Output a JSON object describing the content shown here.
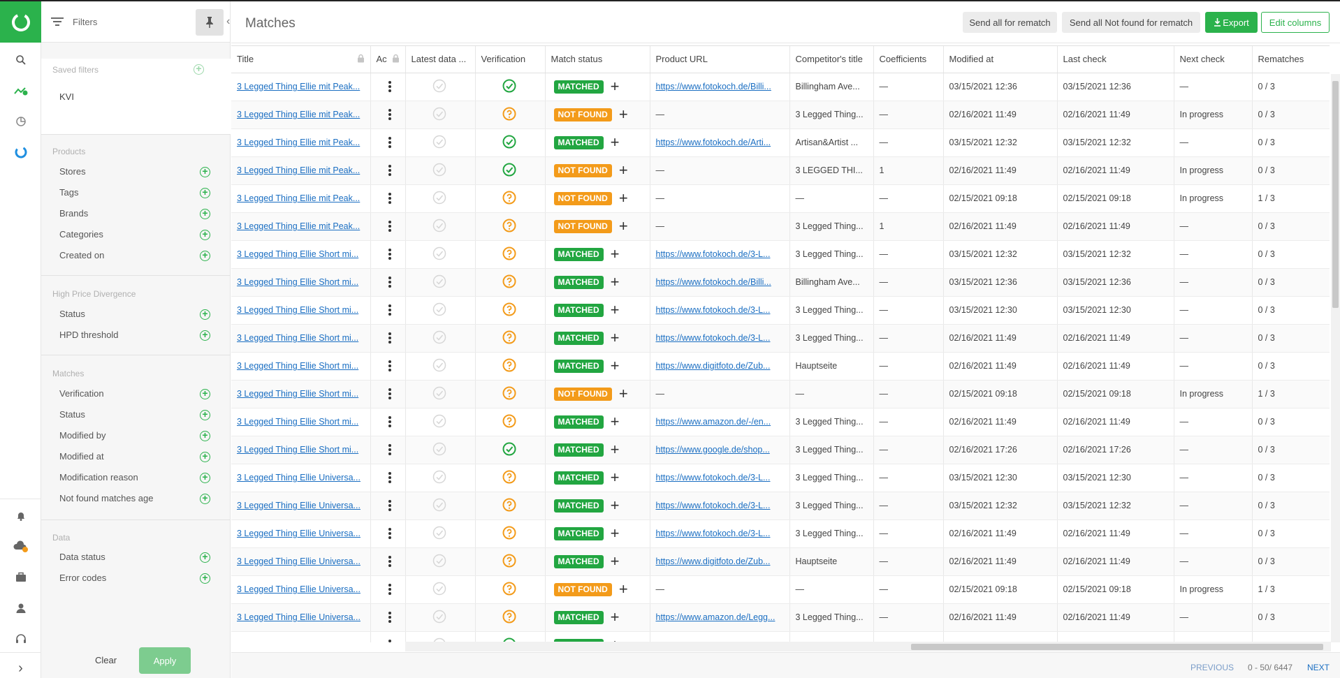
{
  "rail": {
    "logo": "logo-icon",
    "bottom_toggle": "›"
  },
  "filters": {
    "title": "Filters",
    "saved_title": "Saved filters",
    "saved_items": [
      "KVI"
    ],
    "sections": [
      {
        "title": "Products",
        "items": [
          "Stores",
          "Tags",
          "Brands",
          "Categories",
          "Created on"
        ]
      },
      {
        "title": "High Price Divergence",
        "items": [
          "Status",
          "HPD threshold"
        ]
      },
      {
        "title": "Matches",
        "items": [
          "Verification",
          "Status",
          "Modified by",
          "Modified at",
          "Modification reason",
          "Not found matches age"
        ]
      },
      {
        "title": "Data",
        "items": [
          "Data status",
          "Error codes"
        ]
      }
    ],
    "clear": "Clear",
    "apply": "Apply"
  },
  "header": {
    "title": "Matches",
    "rematch_all": "Send all for rematch",
    "rematch_not_found": "Send all Not found for rematch",
    "export": "Export",
    "edit_columns": "Edit columns"
  },
  "table": {
    "columns": [
      "Title",
      "Ac",
      "Latest data ...",
      "Verification",
      "Match status",
      "Product URL",
      "Competitor's title",
      "Coefficients",
      "Modified at",
      "Last check",
      "Next check",
      "Rematches"
    ],
    "rows": [
      {
        "title": "3 Legged Thing Ellie mit Peak...",
        "verif": "check",
        "status": "MATCHED",
        "url": "https://www.fotokoch.de/Billi...",
        "comp": "Billingham Ave...",
        "coef": "—",
        "mod": "03/15/2021 12:36",
        "last": "03/15/2021 12:36",
        "next": "—",
        "rem": "0 / 3"
      },
      {
        "title": "3 Legged Thing Ellie mit Peak...",
        "verif": "question",
        "status": "NOT FOUND",
        "url": "—",
        "comp": "3 Legged Thing...",
        "coef": "—",
        "mod": "02/16/2021 11:49",
        "last": "02/16/2021 11:49",
        "next": "In progress",
        "rem": "0 / 3"
      },
      {
        "title": "3 Legged Thing Ellie mit Peak...",
        "verif": "check",
        "status": "MATCHED",
        "url": "https://www.fotokoch.de/Arti...",
        "comp": "Artisan&Artist ...",
        "coef": "—",
        "mod": "03/15/2021 12:32",
        "last": "03/15/2021 12:32",
        "next": "—",
        "rem": "0 / 3"
      },
      {
        "title": "3 Legged Thing Ellie mit Peak...",
        "verif": "check",
        "status": "NOT FOUND",
        "url": "—",
        "comp": "3 LEGGED THI...",
        "coef": "1",
        "mod": "02/16/2021 11:49",
        "last": "02/16/2021 11:49",
        "next": "In progress",
        "rem": "0 / 3"
      },
      {
        "title": "3 Legged Thing Ellie mit Peak...",
        "verif": "question",
        "status": "NOT FOUND",
        "url": "—",
        "comp": "—",
        "coef": "—",
        "mod": "02/15/2021 09:18",
        "last": "02/15/2021 09:18",
        "next": "In progress",
        "rem": "1 / 3"
      },
      {
        "title": "3 Legged Thing Ellie mit Peak...",
        "verif": "question",
        "status": "NOT FOUND",
        "url": "—",
        "comp": "3 Legged Thing...",
        "coef": "1",
        "mod": "02/16/2021 11:49",
        "last": "02/16/2021 11:49",
        "next": "—",
        "rem": "0 / 3"
      },
      {
        "title": "3 Legged Thing Ellie Short mi...",
        "verif": "question",
        "status": "MATCHED",
        "url": "https://www.fotokoch.de/3-L...",
        "comp": "3 Legged Thing...",
        "coef": "—",
        "mod": "03/15/2021 12:32",
        "last": "03/15/2021 12:32",
        "next": "—",
        "rem": "0 / 3"
      },
      {
        "title": "3 Legged Thing Ellie Short mi...",
        "verif": "question",
        "status": "MATCHED",
        "url": "https://www.fotokoch.de/Billi...",
        "comp": "Billingham Ave...",
        "coef": "—",
        "mod": "03/15/2021 12:36",
        "last": "03/15/2021 12:36",
        "next": "—",
        "rem": "0 / 3"
      },
      {
        "title": "3 Legged Thing Ellie Short mi...",
        "verif": "question",
        "status": "MATCHED",
        "url": "https://www.fotokoch.de/3-L...",
        "comp": "3 Legged Thing...",
        "coef": "—",
        "mod": "03/15/2021 12:30",
        "last": "03/15/2021 12:30",
        "next": "—",
        "rem": "0 / 3"
      },
      {
        "title": "3 Legged Thing Ellie Short mi...",
        "verif": "question",
        "status": "MATCHED",
        "url": "https://www.fotokoch.de/3-L...",
        "comp": "3 Legged Thing...",
        "coef": "—",
        "mod": "02/16/2021 11:49",
        "last": "02/16/2021 11:49",
        "next": "—",
        "rem": "0 / 3"
      },
      {
        "title": "3 Legged Thing Ellie Short mi...",
        "verif": "question",
        "status": "MATCHED",
        "url": "https://www.digitfoto.de/Zub...",
        "comp": "Hauptseite",
        "coef": "—",
        "mod": "02/16/2021 11:49",
        "last": "02/16/2021 11:49",
        "next": "—",
        "rem": "0 / 3"
      },
      {
        "title": "3 Legged Thing Ellie Short mi...",
        "verif": "question",
        "status": "NOT FOUND",
        "url": "—",
        "comp": "—",
        "coef": "—",
        "mod": "02/15/2021 09:18",
        "last": "02/15/2021 09:18",
        "next": "In progress",
        "rem": "1 / 3"
      },
      {
        "title": "3 Legged Thing Ellie Short mi...",
        "verif": "question",
        "status": "MATCHED",
        "url": "https://www.amazon.de/-/en...",
        "comp": "3 Legged Thing...",
        "coef": "—",
        "mod": "02/16/2021 11:49",
        "last": "02/16/2021 11:49",
        "next": "—",
        "rem": "0 / 3"
      },
      {
        "title": "3 Legged Thing Ellie Short mi...",
        "verif": "check",
        "status": "MATCHED",
        "url": "https://www.google.de/shop...",
        "comp": "3 Legged Thing...",
        "coef": "—",
        "mod": "02/16/2021 17:26",
        "last": "02/16/2021 17:26",
        "next": "—",
        "rem": "0 / 3"
      },
      {
        "title": "3 Legged Thing Ellie Universa...",
        "verif": "question",
        "status": "MATCHED",
        "url": "https://www.fotokoch.de/3-L...",
        "comp": "3 Legged Thing...",
        "coef": "—",
        "mod": "03/15/2021 12:30",
        "last": "03/15/2021 12:30",
        "next": "—",
        "rem": "0 / 3"
      },
      {
        "title": "3 Legged Thing Ellie Universa...",
        "verif": "question",
        "status": "MATCHED",
        "url": "https://www.fotokoch.de/3-L...",
        "comp": "3 Legged Thing...",
        "coef": "—",
        "mod": "03/15/2021 12:32",
        "last": "03/15/2021 12:32",
        "next": "—",
        "rem": "0 / 3"
      },
      {
        "title": "3 Legged Thing Ellie Universa...",
        "verif": "question",
        "status": "MATCHED",
        "url": "https://www.fotokoch.de/3-L...",
        "comp": "3 Legged Thing...",
        "coef": "—",
        "mod": "02/16/2021 11:49",
        "last": "02/16/2021 11:49",
        "next": "—",
        "rem": "0 / 3"
      },
      {
        "title": "3 Legged Thing Ellie Universa...",
        "verif": "question",
        "status": "MATCHED",
        "url": "https://www.digitfoto.de/Zub...",
        "comp": "Hauptseite",
        "coef": "—",
        "mod": "02/16/2021 11:49",
        "last": "02/16/2021 11:49",
        "next": "—",
        "rem": "0 / 3"
      },
      {
        "title": "3 Legged Thing Ellie Universa...",
        "verif": "question",
        "status": "NOT FOUND",
        "url": "—",
        "comp": "—",
        "coef": "—",
        "mod": "02/15/2021 09:18",
        "last": "02/15/2021 09:18",
        "next": "In progress",
        "rem": "1 / 3"
      },
      {
        "title": "3 Legged Thing Ellie Universa...",
        "verif": "question",
        "status": "MATCHED",
        "url": "https://www.amazon.de/Legg...",
        "comp": "3 Legged Thing...",
        "coef": "—",
        "mod": "02/16/2021 11:49",
        "last": "02/16/2021 11:49",
        "next": "—",
        "rem": "0 / 3"
      },
      {
        "title": "",
        "verif": "check",
        "status": "MATCHED",
        "url": "",
        "comp": "",
        "coef": "",
        "mod": "",
        "last": "",
        "next": "",
        "rem": ""
      }
    ]
  },
  "pager": {
    "previous": "PREVIOUS",
    "range": "0 - 50/ 6447",
    "next": "NEXT"
  },
  "colors": {
    "brand": "#2bb24c",
    "matched": "#22a641",
    "not_found": "#f39b1a",
    "link": "#1a6ec2"
  }
}
